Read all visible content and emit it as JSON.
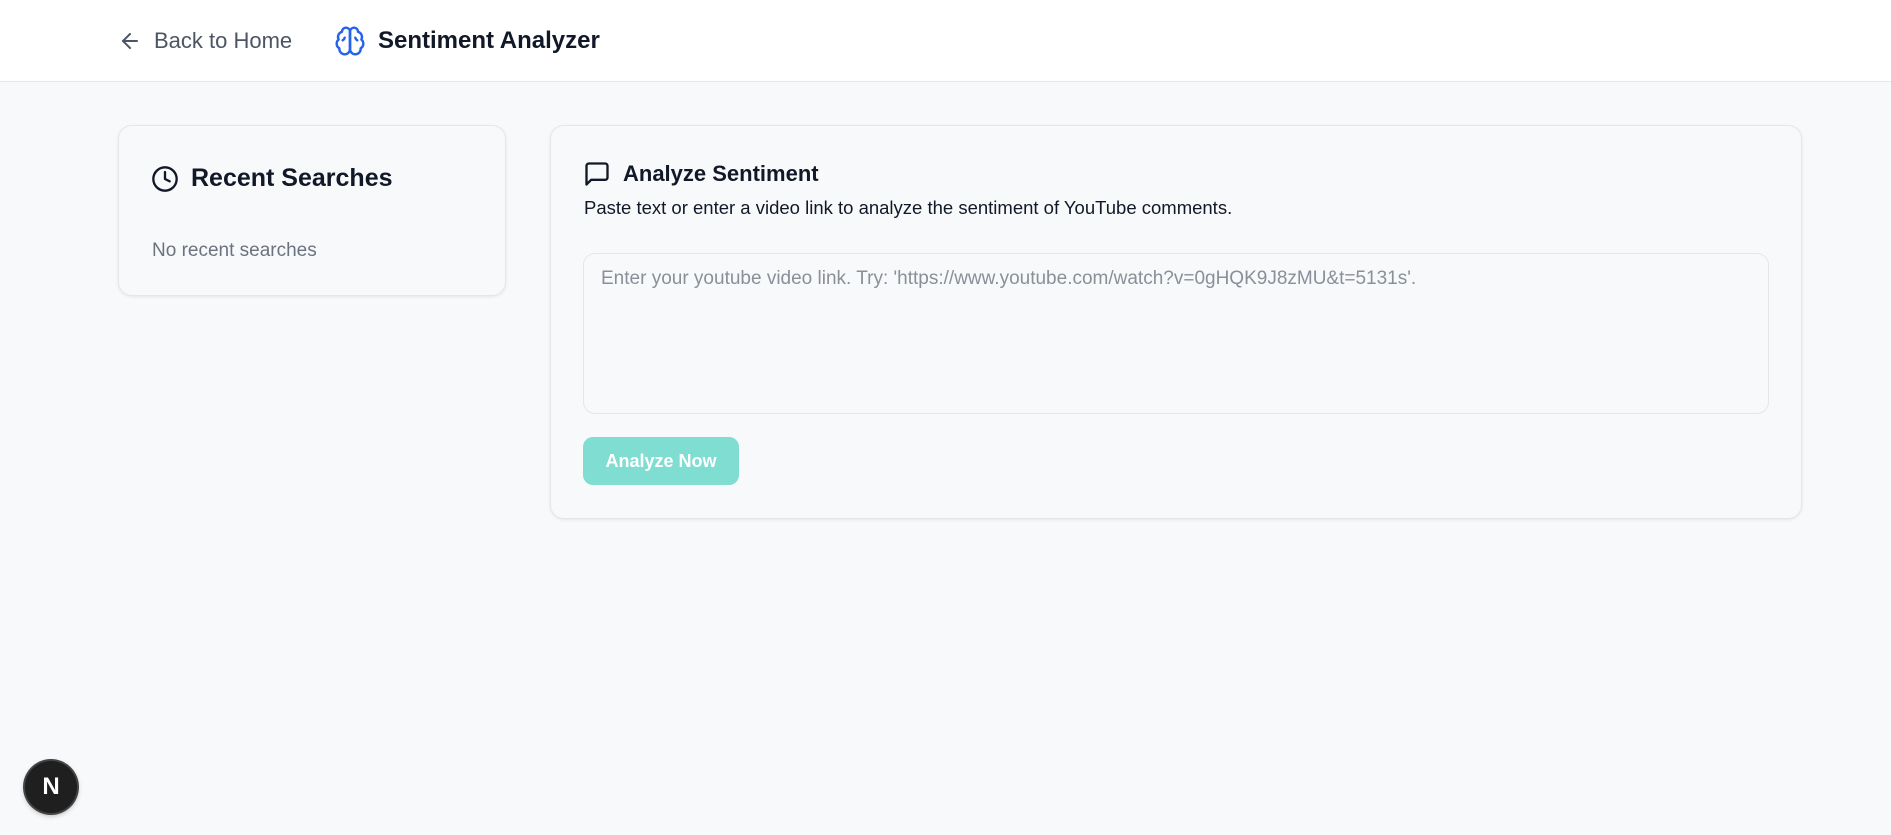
{
  "header": {
    "back_label": "Back to Home",
    "app_title": "Sentiment Analyzer",
    "brand_color": "#2563eb"
  },
  "recent": {
    "title": "Recent Searches",
    "empty_text": "No recent searches"
  },
  "analyze": {
    "title": "Analyze Sentiment",
    "description": "Paste text or enter a video link to analyze the sentiment of YouTube comments.",
    "input_value": "",
    "input_placeholder": "Enter your youtube video link. Try: 'https://www.youtube.com/watch?v=0gHQK9J8zMU&t=5131s'.",
    "button_label": "Analyze Now",
    "button_color": "#7fddd2"
  },
  "dev_badge": {
    "label": "N"
  },
  "icons": [
    "arrow-left-icon",
    "brain-icon",
    "clock-icon",
    "message-square-icon"
  ]
}
